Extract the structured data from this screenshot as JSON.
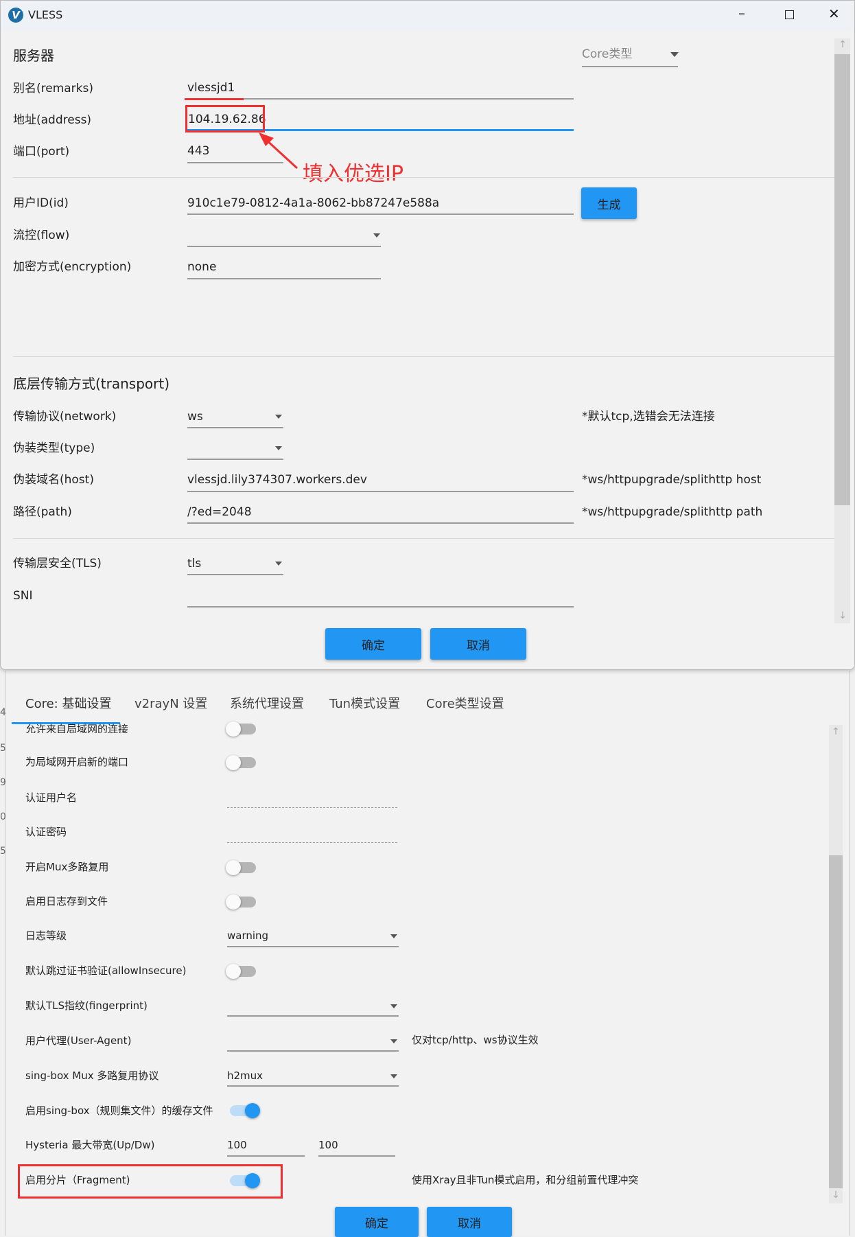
{
  "dialog": {
    "title": "VLESS",
    "section_server": "服务器",
    "core_type_placeholder": "Core类型",
    "fields": {
      "remarks": {
        "label": "别名(remarks)",
        "value": "vlessjd1"
      },
      "address": {
        "label": "地址(address)",
        "value": "104.19.62.86"
      },
      "port": {
        "label": "端口(port)",
        "value": "443"
      },
      "id": {
        "label": "用户ID(id)",
        "value": "910c1e79-0812-4a1a-8062-bb87247e588a"
      },
      "flow": {
        "label": "流控(flow)",
        "value": ""
      },
      "encryption": {
        "label": "加密方式(encryption)",
        "value": "none"
      }
    },
    "generate_label": "生成",
    "section_transport": "底层传输方式(transport)",
    "transport": {
      "network": {
        "label": "传输协议(network)",
        "value": "ws",
        "note": "*默认tcp,选错会无法连接"
      },
      "type": {
        "label": "伪装类型(type)",
        "value": ""
      },
      "host": {
        "label": "伪装域名(host)",
        "value": "vlessjd.lily374307.workers.dev",
        "note": "*ws/httpupgrade/splithttp host"
      },
      "path": {
        "label": "路径(path)",
        "value": "/?ed=2048",
        "note": "*ws/httpupgrade/splithttp path"
      },
      "tls": {
        "label": "传输层安全(TLS)",
        "value": "tls"
      },
      "sni": {
        "label": "SNI",
        "value": ""
      }
    },
    "ok_label": "确定",
    "cancel_label": "取消",
    "annotation": "填入优选IP",
    "annotation_color": "#f03030"
  },
  "settings": {
    "tabs": [
      "Core: 基础设置",
      "v2rayN 设置",
      "系统代理设置",
      "Tun模式设置",
      "Core类型设置"
    ],
    "active_tab": 0,
    "rows": {
      "allow_lan": {
        "label": "允许来自局域网的连接",
        "on": false
      },
      "lan_port": {
        "label": "为局域网开启新的端口",
        "on": false
      },
      "auth_user": {
        "label": "认证用户名",
        "value": ""
      },
      "auth_pass": {
        "label": "认证密码",
        "value": ""
      },
      "mux": {
        "label": "开启Mux多路复用",
        "on": false
      },
      "log_file": {
        "label": "启用日志存到文件",
        "on": false
      },
      "log_level": {
        "label": "日志等级",
        "value": "warning"
      },
      "allow_insecure": {
        "label": "默认跳过证书验证(allowInsecure)",
        "on": false
      },
      "fingerprint": {
        "label": "默认TLS指纹(fingerprint)",
        "value": ""
      },
      "user_agent": {
        "label": "用户代理(User-Agent)",
        "value": "",
        "note": "仅对tcp/http、ws协议生效"
      },
      "singbox_mux": {
        "label": "sing-box Mux 多路复用协议",
        "value": "h2mux"
      },
      "singbox_cache": {
        "label": "启用sing-box（规则集文件）的缓存文件",
        "on": true
      },
      "hysteria": {
        "label": "Hysteria 最大带宽(Up/Dw)",
        "up": "100",
        "down": "100"
      },
      "fragment": {
        "label": "启用分片（Fragment)",
        "on": true,
        "note": "使用Xray且非Tun模式启用，和分组前置代理冲突"
      }
    },
    "ok_label": "确定",
    "cancel_label": "取消"
  },
  "accent_color": "#2196f3"
}
